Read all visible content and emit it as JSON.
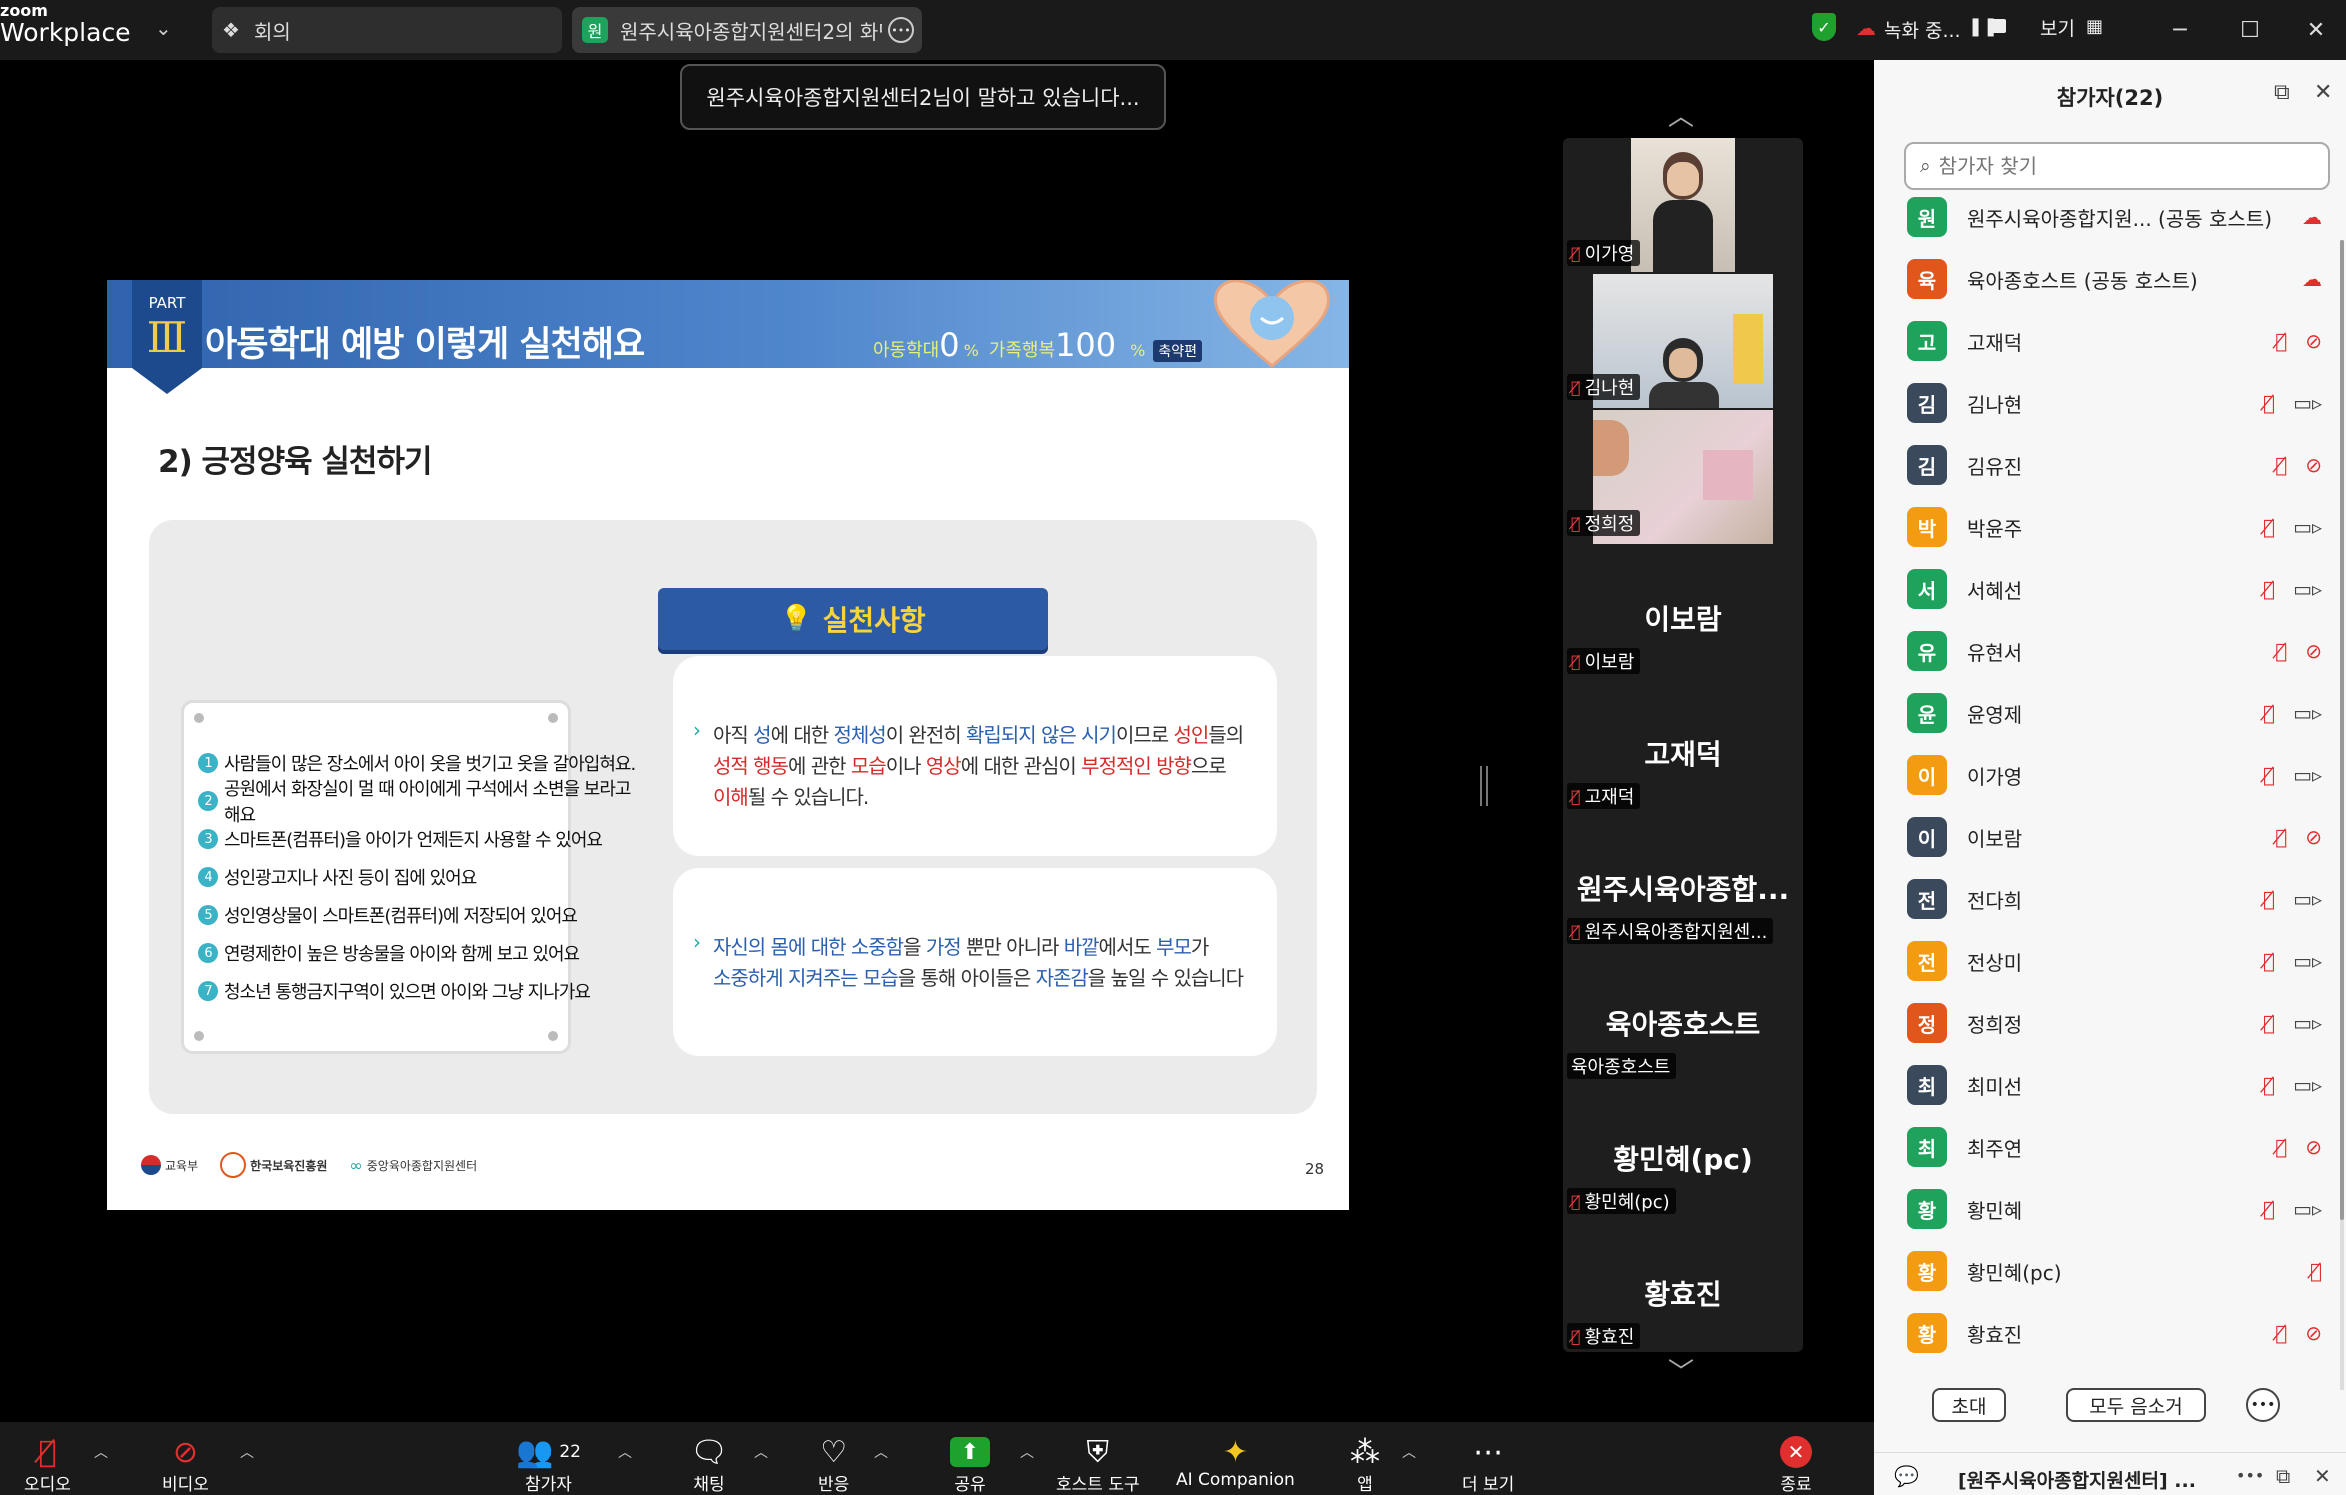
{
  "app": {
    "logo_top": "zoom",
    "logo_bottom": "Workplace"
  },
  "tabs": [
    {
      "label": "회의"
    },
    {
      "avatar": "원",
      "label": "원주시육아종합지원센터2의 화면"
    }
  ],
  "status": {
    "recording": "녹화 중...",
    "view": "보기"
  },
  "colors": {
    "accent_green": "#1fa12e",
    "record_red": "#e02f2f",
    "panel_bg": "#f7f7f7"
  },
  "speaking_banner": "원주시육아종합지원센터2님이 말하고 있습니다...",
  "slide": {
    "part_label": "PART",
    "part_numeral": "Ⅲ",
    "title": "아동학대 예방 이렇게 실천해요",
    "stat1_label": "아동학대",
    "stat1_value": "0",
    "stat1_unit": "%",
    "stat2_label": "가족행복",
    "stat2_value": "100",
    "stat2_unit": "%",
    "badge": "축약편",
    "subtitle": "2) 긍정양육 실천하기",
    "practice_heading": "실천사항",
    "risk_items": [
      "사람들이 많은 장소에서 아이 옷을 벗기고 옷을 갈아입혀요.",
      "공원에서 화장실이 멀 때 아이에게 구석에서 소변을 보라고 해요",
      "스마트폰(컴퓨터)을 아이가 언제든지 사용할 수 있어요",
      "성인광고지나 사진 등이 집에 있어요",
      "성인영상물이 스마트폰(컴퓨터)에 저장되어 있어요",
      "연령제한이 높은 방송물을 아이와 함께 보고 있어요",
      "청소년 통행금지구역이 있으면 아이와 그냥 지나가요"
    ],
    "box1": {
      "p1": "아직 ",
      "p2": "성",
      "p3": "에 대한 ",
      "p4": "정체성",
      "p5": "이 완전히 ",
      "p6": "확립되지 않은 시기",
      "p7": "이므로 ",
      "p8": "성인",
      "p9": "들의",
      "q1": "성적 행동",
      "q2": "에 관한 ",
      "q3": "모습",
      "q4": "이나 ",
      "q5": "영상",
      "q6": "에 대한 관심이 ",
      "q7": "부정적인 방향",
      "q8": "으로",
      "r1": "이해",
      "r2": "될 수 있습니다."
    },
    "box2": {
      "p1": "자신의 몸에 대한 소중함",
      "p2": "을 ",
      "p3": "가정",
      "p4": " 뿐만 아니라 ",
      "p5": "바깥",
      "p6": "에서도 ",
      "p7": "부모",
      "p8": "가",
      "q1": "소중하게 지켜주는 모습",
      "q2": "을 통해 아이들은 ",
      "q3": "자존감",
      "q4": "을 높일 수 있습니다"
    },
    "footer_logos": [
      "교육부",
      "한국보육진흥원",
      "중앙육아종합지원센터"
    ],
    "page_number": "28"
  },
  "video_strip": {
    "tiles": [
      {
        "name": "이가영",
        "muted": true,
        "type": "video"
      },
      {
        "name": "김나현",
        "muted": true,
        "type": "video"
      },
      {
        "name": "정희정",
        "muted": true,
        "type": "video"
      },
      {
        "big": "이보람",
        "name": "이보람",
        "muted": true,
        "type": "name"
      },
      {
        "big": "고재덕",
        "name": "고재덕",
        "muted": true,
        "type": "name"
      },
      {
        "big": "원주시육아종합...",
        "name": "원주시육아종합지원센...",
        "muted": true,
        "type": "name"
      },
      {
        "big": "육아종호스트",
        "name": "육아종호스트",
        "muted": false,
        "type": "name"
      },
      {
        "big": "황민혜(pc)",
        "name": "황민혜(pc)",
        "muted": true,
        "type": "name"
      },
      {
        "big": "황효진",
        "name": "황효진",
        "muted": true,
        "type": "name"
      }
    ]
  },
  "participants_panel": {
    "title": "참가자(22)",
    "search_placeholder": "참가자 찾기",
    "participants": [
      {
        "initial": "원",
        "name": "원주시육아종합지원... (공동 호스트)",
        "color": "#1fa35c",
        "icons": "rec"
      },
      {
        "initial": "육",
        "name": "육아종호스트 (공동 호스트)",
        "color": "#e1561b",
        "icons": "rec"
      },
      {
        "initial": "고",
        "name": "고재덕",
        "color": "#1fa35c",
        "icons": "mute-novideo"
      },
      {
        "initial": "김",
        "name": "김나현",
        "color": "#3a4a5c",
        "icons": "mute-video"
      },
      {
        "initial": "김",
        "name": "김유진",
        "color": "#3a4a5c",
        "icons": "mute-novideo"
      },
      {
        "initial": "박",
        "name": "박윤주",
        "color": "#f39c12",
        "icons": "mute-video"
      },
      {
        "initial": "서",
        "name": "서혜선",
        "color": "#1fa35c",
        "icons": "mute-video"
      },
      {
        "initial": "유",
        "name": "유현서",
        "color": "#1fa35c",
        "icons": "mute-novideo"
      },
      {
        "initial": "윤",
        "name": "윤영제",
        "color": "#1fa35c",
        "icons": "mute-video"
      },
      {
        "initial": "이",
        "name": "이가영",
        "color": "#f39c12",
        "icons": "mute-video"
      },
      {
        "initial": "이",
        "name": "이보람",
        "color": "#3a4a5c",
        "icons": "mute-novideo"
      },
      {
        "initial": "전",
        "name": "전다희",
        "color": "#3a4a5c",
        "icons": "mute-video"
      },
      {
        "initial": "전",
        "name": "전상미",
        "color": "#f39c12",
        "icons": "mute-video"
      },
      {
        "initial": "정",
        "name": "정희정",
        "color": "#e1561b",
        "icons": "mute-video"
      },
      {
        "initial": "최",
        "name": "최미선",
        "color": "#3a4a5c",
        "icons": "mute-video"
      },
      {
        "initial": "최",
        "name": "최주연",
        "color": "#1fa35c",
        "icons": "mute-novideo"
      },
      {
        "initial": "황",
        "name": "황민혜",
        "color": "#1fa35c",
        "icons": "mute-video"
      },
      {
        "initial": "황",
        "name": "황민혜(pc)",
        "color": "#f39c12",
        "icons": "mute"
      },
      {
        "initial": "황",
        "name": "황효진",
        "color": "#f39c12",
        "icons": "mute-novideo"
      }
    ],
    "invite_label": "초대",
    "mute_all_label": "모두 음소거",
    "chat_preview": "[원주시육아종합지원센터] ..."
  },
  "toolbar": {
    "audio": "오디오",
    "video": "비디오",
    "participants": "참가자",
    "participants_count": "22",
    "chat": "채팅",
    "react": "반응",
    "share": "공유",
    "host_tools": "호스트 도구",
    "ai": "AI Companion",
    "apps": "앱",
    "more": "더 보기",
    "end": "종료"
  }
}
